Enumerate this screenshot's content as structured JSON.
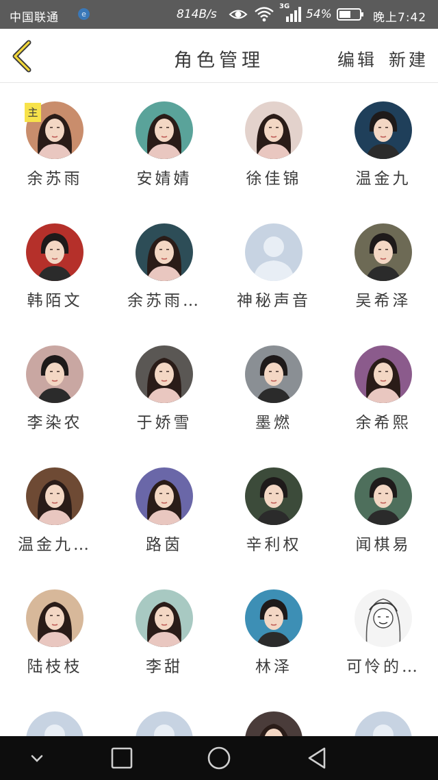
{
  "status_bar": {
    "carrier": "中国联通",
    "carrier_badge": "e",
    "net_speed": "814B/s",
    "network_type": "3G",
    "battery_percent": "54%",
    "time": "晚上7:42"
  },
  "header": {
    "title": "角色管理",
    "edit_label": "编辑",
    "new_label": "新建"
  },
  "main_badge": "主",
  "characters": [
    {
      "name": "余苏雨",
      "avatar": "female-portrait",
      "color": "#c98d6c",
      "main": true
    },
    {
      "name": "安婧婧",
      "avatar": "female-portrait",
      "color": "#5aa39a"
    },
    {
      "name": "徐佳锦",
      "avatar": "female-portrait",
      "color": "#e3d2cc"
    },
    {
      "name": "温金九",
      "avatar": "male-portrait",
      "color": "#1f3f5a"
    },
    {
      "name": "韩陌文",
      "avatar": "male-portrait",
      "color": "#b5302a"
    },
    {
      "name": "余苏雨…",
      "avatar": "female-portrait",
      "color": "#2d4d57"
    },
    {
      "name": "神秘声音",
      "avatar": "placeholder",
      "color": "#c7d3e2"
    },
    {
      "name": "吴希泽",
      "avatar": "male-portrait",
      "color": "#6d6a55"
    },
    {
      "name": "李染农",
      "avatar": "male-portrait",
      "color": "#c9a7a2"
    },
    {
      "name": "于娇雪",
      "avatar": "female-portrait",
      "color": "#5a5754"
    },
    {
      "name": "墨燃",
      "avatar": "male-portrait",
      "color": "#8a8f94"
    },
    {
      "name": "余希熙",
      "avatar": "female-portrait",
      "color": "#8b5b8c"
    },
    {
      "name": "温金九…",
      "avatar": "female-portrait",
      "color": "#6e4a34"
    },
    {
      "name": "路茵",
      "avatar": "female-portrait",
      "color": "#6a67a8"
    },
    {
      "name": "辛利权",
      "avatar": "male-portrait",
      "color": "#3c4b3a"
    },
    {
      "name": "闻棋易",
      "avatar": "male-portrait",
      "color": "#4e6f5c"
    },
    {
      "name": "陆枝枝",
      "avatar": "female-portrait",
      "color": "#d7b89a"
    },
    {
      "name": "李甜",
      "avatar": "female-portrait",
      "color": "#a8c9c2"
    },
    {
      "name": "林泽",
      "avatar": "male-portrait",
      "color": "#3d8fb5"
    },
    {
      "name": "可怜的…",
      "avatar": "sketch-portrait",
      "color": "#f2f2f2"
    },
    {
      "name": "",
      "avatar": "placeholder",
      "color": "#c7d3e2"
    },
    {
      "name": "",
      "avatar": "placeholder",
      "color": "#c7d3e2"
    },
    {
      "name": "",
      "avatar": "female-portrait",
      "color": "#4a3c3a"
    },
    {
      "name": "",
      "avatar": "placeholder",
      "color": "#c7d3e2"
    }
  ],
  "nav_bar": {
    "buttons": [
      "collapse-icon",
      "recents-icon",
      "home-icon",
      "back-icon"
    ]
  }
}
